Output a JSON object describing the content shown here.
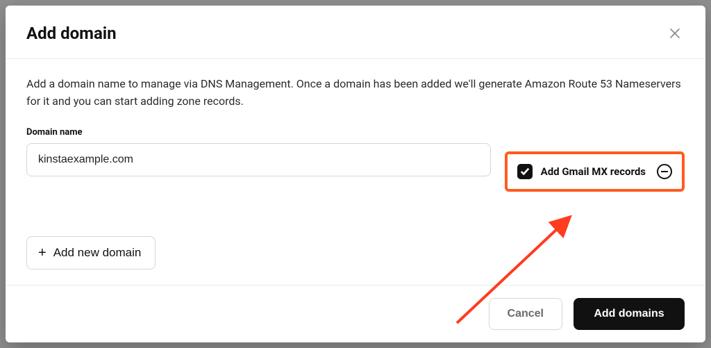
{
  "modal": {
    "title": "Add domain",
    "description": "Add a domain name to manage via DNS Management. Once a domain has been added we'll generate Amazon Route 53 Nameservers for it and you can start adding zone records.",
    "field_label": "Domain name",
    "domain_value": "kinstaexample.com",
    "mx_checkbox_label": "Add Gmail MX records",
    "mx_checked": true,
    "add_new_domain_label": "Add new domain",
    "cancel_label": "Cancel",
    "submit_label": "Add domains"
  },
  "colors": {
    "highlight": "#ff5b1f",
    "primary": "#111111"
  }
}
